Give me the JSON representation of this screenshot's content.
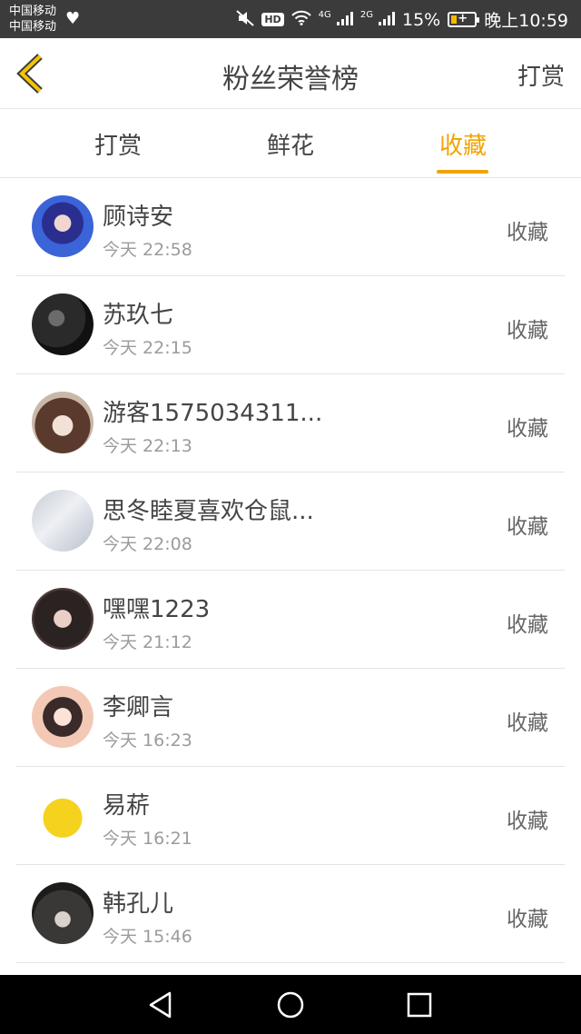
{
  "status_bar": {
    "carrier1": "中国移动",
    "carrier2": "中国移动",
    "network1": "4G",
    "network2": "2G",
    "battery_label": "15%",
    "battery_level": 0.15,
    "time": "晚上10:59"
  },
  "header": {
    "title": "粉丝荣誉榜",
    "action": "打赏"
  },
  "tabs": [
    {
      "label": "打赏",
      "active": false
    },
    {
      "label": "鲜花",
      "active": false
    },
    {
      "label": "收藏",
      "active": true
    }
  ],
  "accent_color": "#f0a400",
  "rows": [
    {
      "name": "顾诗安",
      "time": "今天 22:58",
      "type": "收藏"
    },
    {
      "name": "苏玖七",
      "time": "今天 22:15",
      "type": "收藏"
    },
    {
      "name": "游客1575034311...",
      "time": "今天 22:13",
      "type": "收藏"
    },
    {
      "name": "思冬睦夏喜欢仓鼠...",
      "time": "今天 22:08",
      "type": "收藏"
    },
    {
      "name": "嘿嘿1223",
      "time": "今天 21:12",
      "type": "收藏"
    },
    {
      "name": "李卿言",
      "time": "今天 16:23",
      "type": "收藏"
    },
    {
      "name": "易菥",
      "time": "今天 16:21",
      "type": "收藏"
    },
    {
      "name": "韩孔儿",
      "time": "今天 15:46",
      "type": "收藏"
    }
  ]
}
